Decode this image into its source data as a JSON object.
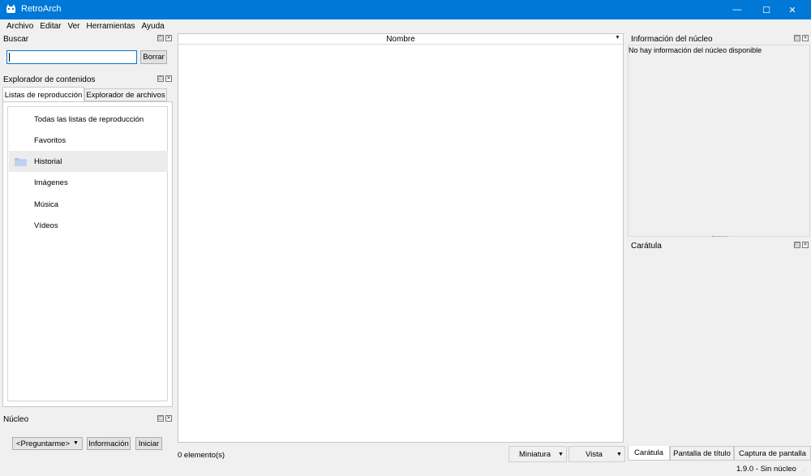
{
  "window": {
    "title": "RetroArch",
    "controls": {
      "minimize": "—",
      "maximize": "☐",
      "close": "✕"
    }
  },
  "menubar": {
    "items": [
      {
        "label": "Archivo"
      },
      {
        "label": "Editar"
      },
      {
        "label": "Ver"
      },
      {
        "label": "Herramientas"
      },
      {
        "label": "Ayuda"
      }
    ]
  },
  "search_panel": {
    "title": "Buscar",
    "input_value": "",
    "clear_button": "Borrar"
  },
  "content_browser": {
    "title": "Explorador de contenidos",
    "tabs": [
      {
        "label": "Listas de reproducción",
        "active": true
      },
      {
        "label": "Explorador de archivos",
        "active": false
      }
    ],
    "playlists": [
      {
        "label": "Todas las listas de reproducción",
        "selected": false,
        "icon": ""
      },
      {
        "label": "Favoritos",
        "selected": false,
        "icon": ""
      },
      {
        "label": "Historial",
        "selected": true,
        "icon": "folder-icon"
      },
      {
        "label": "Imágenes",
        "selected": false,
        "icon": ""
      },
      {
        "label": "Música",
        "selected": false,
        "icon": ""
      },
      {
        "label": "Vídeos",
        "selected": false,
        "icon": ""
      }
    ]
  },
  "core_panel": {
    "title": "Núcleo",
    "core_select_value": "<Preguntarme>",
    "info_button": "Información",
    "start_button": "Iniciar"
  },
  "content_list": {
    "column_header": "Nombre",
    "item_count": "0 elemento(s)",
    "view_type_value": "Miniatura",
    "view_mode_value": "Vista"
  },
  "core_info_panel": {
    "title": "Información del núcleo",
    "message": "No hay información del núcleo disponible"
  },
  "cover_panel": {
    "title": "Carátula",
    "tabs": [
      {
        "label": "Carátula",
        "active": true
      },
      {
        "label": "Pantalla de título",
        "active": false
      },
      {
        "label": "Captura de pantalla",
        "active": false
      }
    ]
  },
  "statusbar": {
    "text": "1.9.0 - Sin núcleo"
  },
  "colors": {
    "titlebar": "#0078d7",
    "window_bg": "#f0f0f0",
    "folder_icon": "#a9c6e8"
  }
}
